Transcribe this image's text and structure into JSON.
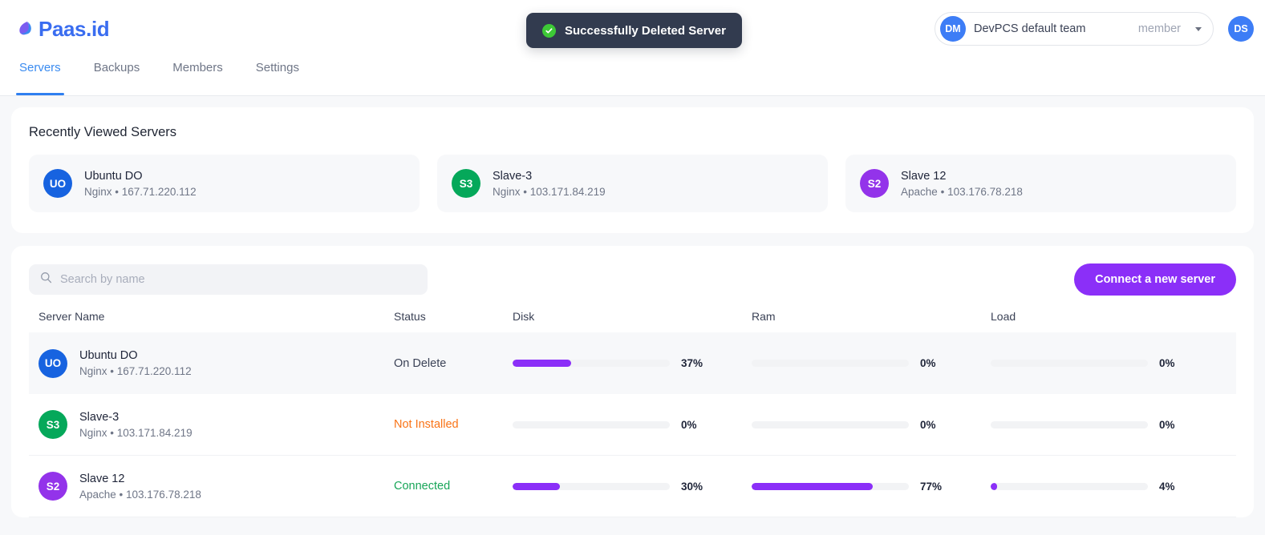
{
  "brand": {
    "name": "Paas.id",
    "accent": "#3a6df0",
    "logo_icon": "leaf-droplet-icon"
  },
  "toast": {
    "message": "Successfully Deleted Server",
    "icon": "check-circle-icon",
    "icon_color": "#3dc936",
    "background": "#323b4f"
  },
  "team": {
    "initials": "DM",
    "name": "DevPCS default team",
    "role": "member",
    "caret_icon": "chevron-down-icon"
  },
  "user": {
    "initials": "DS"
  },
  "nav": {
    "tabs": [
      {
        "label": "Servers",
        "active": true
      },
      {
        "label": "Backups",
        "active": false
      },
      {
        "label": "Members",
        "active": false
      },
      {
        "label": "Settings",
        "active": false
      }
    ]
  },
  "recent": {
    "title": "Recently Viewed Servers",
    "servers": [
      {
        "initials": "UO",
        "color": "#1763e0",
        "name": "Ubuntu DO",
        "stack": "Nginx",
        "sep": "•",
        "ip": "167.71.220.112"
      },
      {
        "initials": "S3",
        "color": "#05a85a",
        "name": "Slave-3",
        "stack": "Nginx",
        "sep": "•",
        "ip": "103.171.84.219"
      },
      {
        "initials": "S2",
        "color": "#9333ea",
        "name": "Slave 12",
        "stack": "Apache",
        "sep": "•",
        "ip": "103.176.78.218"
      }
    ]
  },
  "table": {
    "search": {
      "placeholder": "Search by name",
      "value": "",
      "icon": "search-icon"
    },
    "connect_button": "Connect a new server",
    "headers": {
      "name": "Server Name",
      "status": "Status",
      "disk": "Disk",
      "ram": "Ram",
      "load": "Load"
    },
    "bar_color": "#8b2ff8",
    "rows": [
      {
        "initials": "UO",
        "color": "#1763e0",
        "name": "Ubuntu DO",
        "stack": "Nginx",
        "sep": "•",
        "ip": "167.71.220.112",
        "status": "On Delete",
        "status_color": "#3b4256",
        "disk": 37,
        "disk_label": "37%",
        "ram": 0,
        "ram_label": "0%",
        "load": 0,
        "load_label": "0%",
        "highlight": true
      },
      {
        "initials": "S3",
        "color": "#05a85a",
        "name": "Slave-3",
        "stack": "Nginx",
        "sep": "•",
        "ip": "103.171.84.219",
        "status": "Not Installed",
        "status_color": "#f97316",
        "disk": 0,
        "disk_label": "0%",
        "ram": 0,
        "ram_label": "0%",
        "load": 0,
        "load_label": "0%",
        "highlight": false
      },
      {
        "initials": "S2",
        "color": "#9333ea",
        "name": "Slave 12",
        "stack": "Apache",
        "sep": "•",
        "ip": "103.176.78.218",
        "status": "Connected",
        "status_color": "#18a558",
        "disk": 30,
        "disk_label": "30%",
        "ram": 77,
        "ram_label": "77%",
        "load": 4,
        "load_label": "4%",
        "highlight": false
      }
    ]
  }
}
